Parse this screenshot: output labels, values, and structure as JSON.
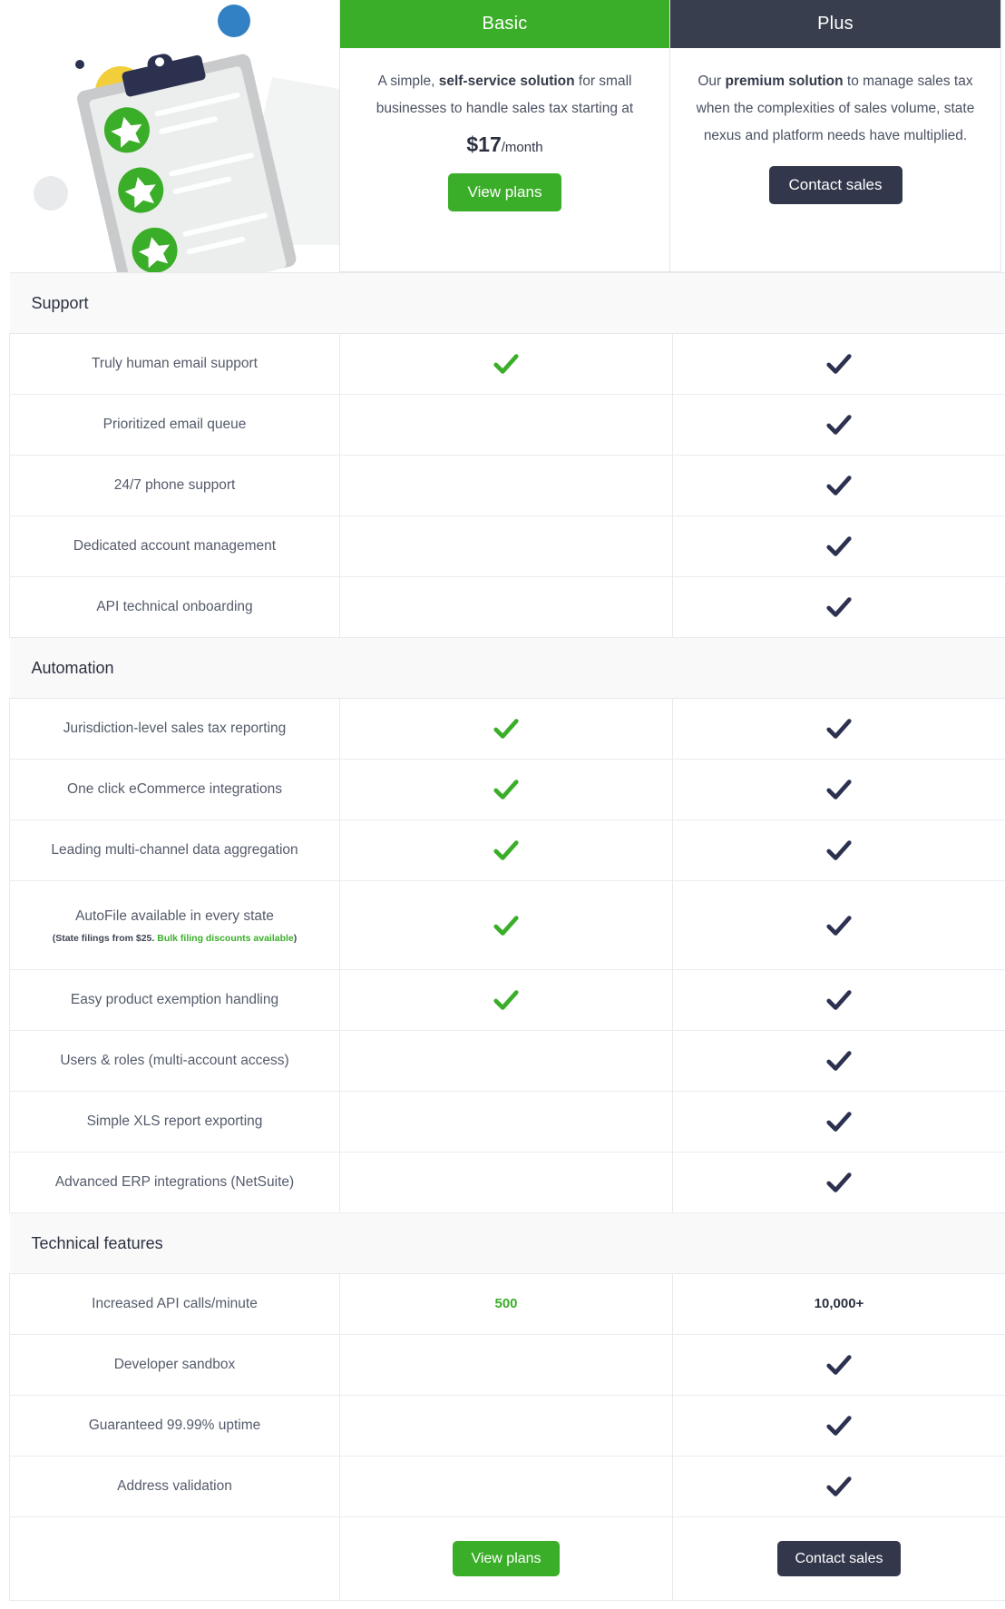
{
  "illustration": {
    "name": "clipboard-checklist-illustration",
    "colors": {
      "blue_dot": "#3281c4",
      "yellow_dot": "#f2ce3a",
      "grey_dot": "#e9eaeb",
      "navy_dot": "#2c3150",
      "clipboard_board": "#c9cacc",
      "clipboard_paper": "#eceded",
      "clip": "#2c3150",
      "star_badge": "#3BAE29"
    }
  },
  "plans": [
    {
      "key": "basic",
      "name": "Basic",
      "banner_color": "#3BAE29",
      "desc_pre": "A simple, ",
      "desc_bold": "self-service solution",
      "desc_post": " for small businesses to handle sales tax starting at",
      "price_amount": "$17",
      "price_period": "/month",
      "cta_label": "View plans",
      "cta_style": "green"
    },
    {
      "key": "plus",
      "name": "Plus",
      "banner_color": "#383E4D",
      "desc_pre": "Our ",
      "desc_bold": "premium solution",
      "desc_post": " to manage sales tax when the complexities of sales volume, state nexus and platform needs have multiplied.",
      "price_amount": "",
      "price_period": "",
      "cta_label": "Contact sales",
      "cta_style": "dark"
    }
  ],
  "sections": [
    {
      "title": "Support",
      "rows": [
        {
          "feature": "Truly human email support",
          "sub": null,
          "basic": "check-green",
          "plus": "check-dark"
        },
        {
          "feature": "Prioritized email queue",
          "sub": null,
          "basic": "",
          "plus": "check-dark"
        },
        {
          "feature": "24/7 phone support",
          "sub": null,
          "basic": "",
          "plus": "check-dark"
        },
        {
          "feature": "Dedicated account management",
          "sub": null,
          "basic": "",
          "plus": "check-dark"
        },
        {
          "feature": "API technical onboarding",
          "sub": null,
          "basic": "",
          "plus": "check-dark"
        }
      ]
    },
    {
      "title": "Automation",
      "rows": [
        {
          "feature": "Jurisdiction-level sales tax reporting",
          "sub": null,
          "basic": "check-green",
          "plus": "check-dark"
        },
        {
          "feature": "One click eCommerce integrations",
          "sub": null,
          "basic": "check-green",
          "plus": "check-dark"
        },
        {
          "feature": "Leading multi-channel data aggregation",
          "sub": null,
          "basic": "check-green",
          "plus": "check-dark"
        },
        {
          "feature": "AutoFile available in every state",
          "sub": {
            "plain": "(State filings from $25. ",
            "highlight": "Bulk filing discounts available",
            "tail": ")"
          },
          "basic": "check-green",
          "plus": "check-dark",
          "tall": true
        },
        {
          "feature": "Easy product exemption handling",
          "sub": null,
          "basic": "check-green",
          "plus": "check-dark"
        },
        {
          "feature": "Users & roles (multi-account access)",
          "sub": null,
          "basic": "",
          "plus": "check-dark"
        },
        {
          "feature": "Simple XLS report exporting",
          "sub": null,
          "basic": "",
          "plus": "check-dark"
        },
        {
          "feature": "Advanced ERP integrations (NetSuite)",
          "sub": null,
          "basic": "",
          "plus": "check-dark"
        }
      ]
    },
    {
      "title": "Technical features",
      "rows": [
        {
          "feature": "Increased API calls/minute",
          "sub": null,
          "basic": "500",
          "plus": "10,000+",
          "value_row": true
        },
        {
          "feature": "Developer sandbox",
          "sub": null,
          "basic": "",
          "plus": "check-dark"
        },
        {
          "feature": "Guaranteed 99.99% uptime",
          "sub": null,
          "basic": "",
          "plus": "check-dark"
        },
        {
          "feature": "Address validation",
          "sub": null,
          "basic": "",
          "plus": "check-dark"
        }
      ]
    }
  ],
  "footer_cta": {
    "basic_label": "View plans",
    "plus_label": "Contact sales"
  },
  "colors": {
    "green": "#3BAE29",
    "dark_navy": "#2c3150",
    "header_dark": "#383E4D",
    "text": "#545b6b",
    "border": "#e8e9ec",
    "section_bg": "#f9f9fa"
  }
}
